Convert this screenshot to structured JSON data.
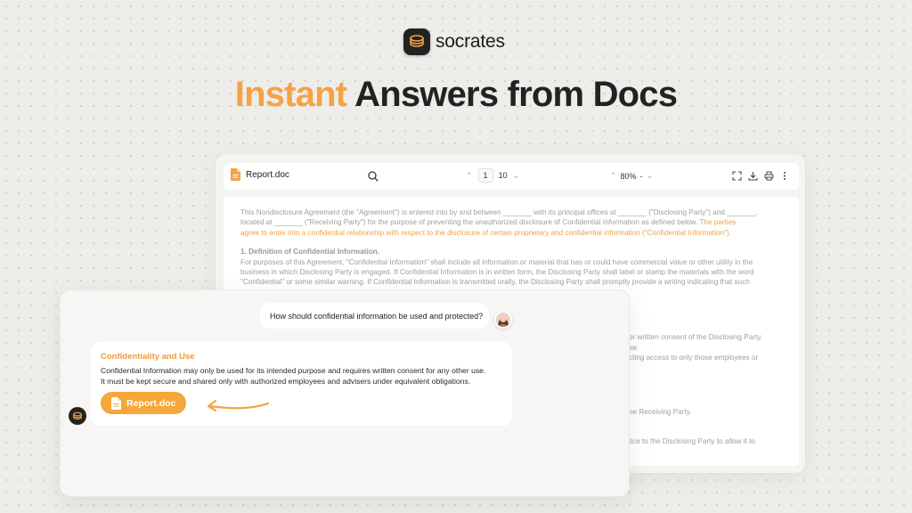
{
  "brand": {
    "name": "socrates",
    "logo_icon": "coin-stack-icon"
  },
  "headline": {
    "accent": "Instant",
    "rest": " Answers from Docs"
  },
  "viewer": {
    "file_name": "Report.doc",
    "current_page": "1",
    "total_pages": "10",
    "zoom": "80%",
    "zoom_step": "-",
    "document": {
      "intro_lines": [
        "This Nondisclosure Agreement (the \"Agreement\") is entered into by and between _______ with its principal offices at _______ (\"Disclosing Party\") and _______,",
        "located at _______ (\"Receiving Party\") for the  purpose of preventing the unauthorized disclosure of Confidential Information as defined below."
      ],
      "intro_highlight_a": " The parties",
      "intro_highlight_b": "agree to enter into a confidential relationship with respect to the disclosure of certain proprietary and confidential information (\"Confidential Information\").",
      "section_title": "1. Definition of Confidential Information.",
      "section_lines": [
        "For purposes of this Agreement, \"Confidential Information\" shall include all information or material that has or could have commercial value or other utility in the",
        "business in which Disclosing Party is engaged. If Confidential Information is in written form, the Disclosing Party shall label or stamp the materials with the word",
        "\"Confidential\" or some similar warning. If Confidential Information is transmitted orally, the Disclosing Party shall promptly provide a writing indicating that such"
      ],
      "partial_lines": [
        "or written consent of the Disclosing Party.",
        "se.",
        "cting access to only those employees or",
        "ne Receiving Party.",
        "tice to the Disclosing Party to allow it to"
      ]
    }
  },
  "chat": {
    "question": "How should confidential information be used and protected?",
    "answer_title": "Confidentiality and Use",
    "answer_lines": [
      "Confidential Information may only be used for its intended purpose and requires written consent for any other use.",
      "It must be kept secure and shared only with authorized employees and advisers under equivalent obligations."
    ],
    "source_label": "Report.doc"
  },
  "colors": {
    "accent": "#f4a245",
    "button": "#f5a73b",
    "background": "#efedea"
  }
}
